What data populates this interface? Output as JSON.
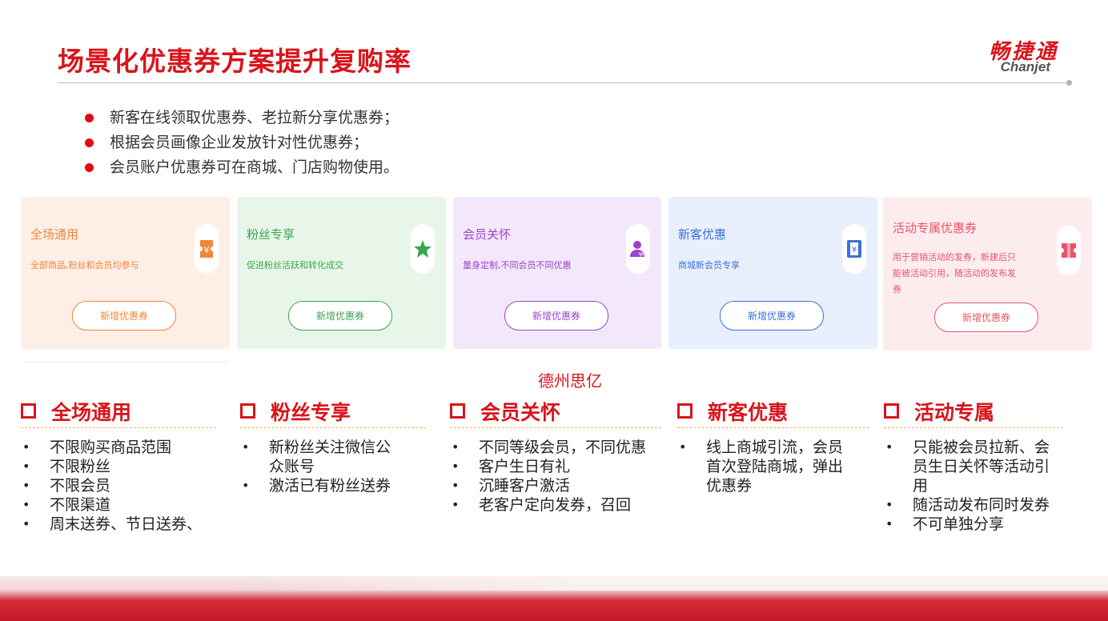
{
  "title": "场景化优惠券方案提升复购率",
  "logo": {
    "cn": "畅捷通",
    "en": "Chanjet"
  },
  "bullets": [
    "新客在线领取优惠券、老拉新分享优惠券；",
    "根据会员画像企业发放针对性优惠券；",
    "会员账户优惠券可在商城、门店购物使用。"
  ],
  "cards": [
    {
      "title": "全场通用",
      "desc": "全部商品,粉丝和会员均参与",
      "button": "新增优惠券",
      "icon": "coupon-icon",
      "bg": "#fdeee6",
      "accent": "#f0883a"
    },
    {
      "title": "粉丝专享",
      "desc": "促进粉丝活跃和转化成交",
      "button": "新增优惠券",
      "icon": "star-icon",
      "bg": "#e8f6ea",
      "accent": "#3aa64a"
    },
    {
      "title": "会员关怀",
      "desc": "量身定制,不同会员不同优惠",
      "button": "新增优惠券",
      "icon": "member-icon",
      "bg": "#f3e8fb",
      "accent": "#9b44cc"
    },
    {
      "title": "新客优惠",
      "desc": "商城新会员专享",
      "button": "新增优惠券",
      "icon": "ticket-icon",
      "bg": "#e8f0fd",
      "accent": "#3b72d6"
    },
    {
      "title": "活动专属优惠券",
      "desc": "用于营销活动的发券，新建后只能被活动引用，随活动的发布发券",
      "button": "新增优惠券",
      "icon": "gift-coupon-icon",
      "bg": "#fdecee",
      "accent": "#e8556a"
    }
  ],
  "watermark": "德州思亿",
  "sections": [
    {
      "title": "全场通用",
      "items": [
        "不限购买商品范围",
        "不限粉丝",
        "不限会员",
        "不限渠道",
        "周末送券、节日送券、"
      ]
    },
    {
      "title": "粉丝专享",
      "items": [
        "新粉丝关注微信公众账号",
        "激活已有粉丝送券"
      ]
    },
    {
      "title": "会员关怀",
      "items": [
        "不同等级会员，不同优惠",
        "客户生日有礼",
        "沉睡客户激活",
        "老客户定向发券，召回"
      ]
    },
    {
      "title": "新客优惠",
      "items": [
        "线上商城引流，会员首次登陆商城，弹出优惠券"
      ]
    },
    {
      "title": "活动专属",
      "items": [
        "只能被会员拉新、会员生日关怀等活动引用",
        "随活动发布同时发券",
        "不可单独分享"
      ]
    }
  ],
  "colors": {
    "brand": "#d9141b",
    "bullet": "#e10c16",
    "divider": "#efb552"
  }
}
